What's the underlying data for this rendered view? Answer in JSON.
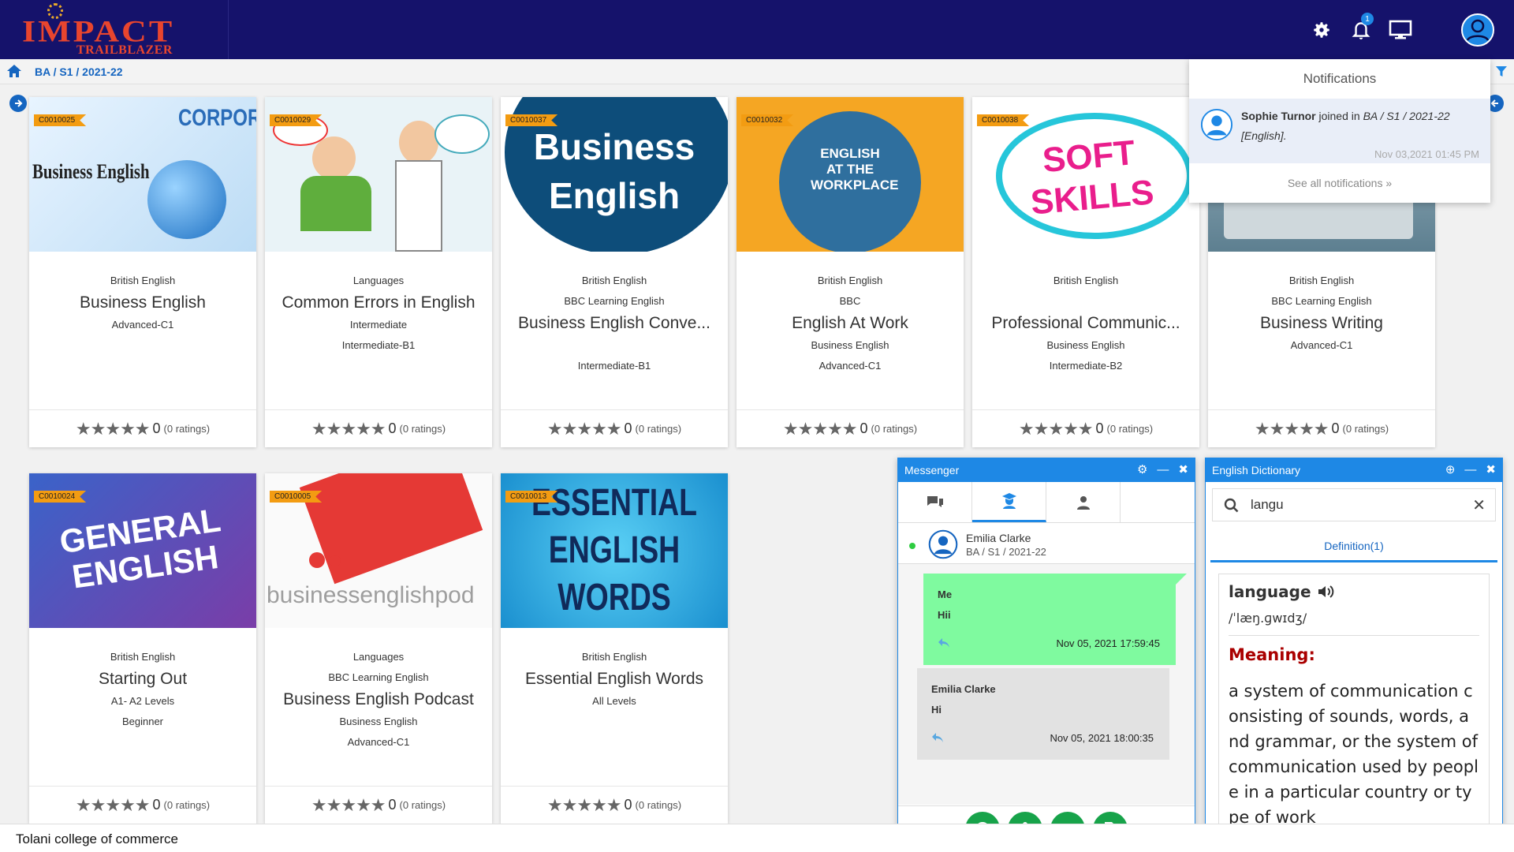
{
  "header": {
    "logo_main": "IMPACT",
    "logo_sub": "TRAILBLAZER",
    "notification_count": "1"
  },
  "breadcrumb": "BA / S1 / 2021-22",
  "colors": {
    "header_bg": "#15126b",
    "accent": "#1e88e5",
    "code_tag": "#f39c12",
    "me_bubble": "#7ffa9f",
    "action_green": "#17a34a"
  },
  "courses": [
    {
      "code": "C0010025",
      "lines": [
        "British English"
      ],
      "title": "Business English",
      "after": [
        "Advanced-C1"
      ],
      "rating": "0",
      "ratings_label": "(0 ratings)",
      "img_text": "Business English"
    },
    {
      "code": "C0010029",
      "lines": [
        "Languages"
      ],
      "title": "Common Errors in English",
      "after": [
        "Intermediate",
        "Intermediate-B1"
      ],
      "rating": "0",
      "ratings_label": "(0 ratings)",
      "img_text": ""
    },
    {
      "code": "C0010037",
      "lines": [
        "British English",
        "BBC Learning English"
      ],
      "title": "Business English Conve...",
      "after": [
        "",
        "Intermediate-B1"
      ],
      "rating": "0",
      "ratings_label": "(0 ratings)",
      "img_text": "Business English"
    },
    {
      "code": "C0010032",
      "lines": [
        "British English",
        "BBC"
      ],
      "title": "English At Work",
      "after": [
        "Business English",
        "Advanced-C1"
      ],
      "rating": "0",
      "ratings_label": "(0 ratings)",
      "img_text": "ENGLISH AT THE WORKPLACE"
    },
    {
      "code": "C0010038",
      "lines": [
        "British English",
        ""
      ],
      "title": "Professional Communic...",
      "after": [
        "Business English",
        "Intermediate-B2"
      ],
      "rating": "0",
      "ratings_label": "(0 ratings)",
      "img_text": "SOFT SKILLS"
    },
    {
      "code": "",
      "lines": [
        "British English",
        "BBC Learning English"
      ],
      "title": "Business Writing",
      "after": [
        "Advanced-C1"
      ],
      "rating": "0",
      "ratings_label": "(0 ratings)",
      "img_text": ""
    },
    {
      "code": "C0010024",
      "lines": [
        "British English"
      ],
      "title": "Starting Out",
      "after": [
        "A1- A2 Levels",
        "Beginner"
      ],
      "rating": "0",
      "ratings_label": "(0 ratings)",
      "img_text": "GENERAL ENGLISH"
    },
    {
      "code": "C0010005",
      "lines": [
        "Languages",
        "BBC Learning English"
      ],
      "title": "Business English Podcast",
      "after": [
        "Business English",
        "Advanced-C1"
      ],
      "rating": "0",
      "ratings_label": "(0 ratings)",
      "img_text": "businessenglishpod"
    },
    {
      "code": "C0010013",
      "lines": [
        "British English"
      ],
      "title": "Essential English Words",
      "after": [
        "All Levels"
      ],
      "rating": "0",
      "ratings_label": "(0 ratings)",
      "img_text": "ESSENTIAL ENGLISH WORDS"
    }
  ],
  "notifications": {
    "title": "Notifications",
    "item": {
      "name": "Sophie Turnor",
      "text": " joined in ",
      "place": "BA / S1 / 2021-22",
      "course": "[English].",
      "time": "Nov 03,2021 01:45 PM"
    },
    "see_all": "See all notifications »"
  },
  "messenger": {
    "title": "Messenger",
    "contact_name": "Emilia Clarke",
    "contact_sub": "BA / S1 / 2021-22",
    "messages": [
      {
        "sender": "Me",
        "text": "Hii",
        "time": "Nov 05, 2021 17:59:45"
      },
      {
        "sender": "Emilia Clarke",
        "text": "Hi",
        "time": "Nov 05, 2021 18:00:35"
      }
    ]
  },
  "dictionary": {
    "title": "English Dictionary",
    "search_value": "langu",
    "tab": "Definition(1)",
    "word": "language",
    "phonetic": "/ˈlæŋ.ɡwɪdʒ/",
    "meaning_label": "Meaning:",
    "meaning": "a system of communication consisting of sounds, words, and grammar, or the system of communication used by people in a particular country or type of work"
  },
  "footer": "Tolani college of commerce"
}
